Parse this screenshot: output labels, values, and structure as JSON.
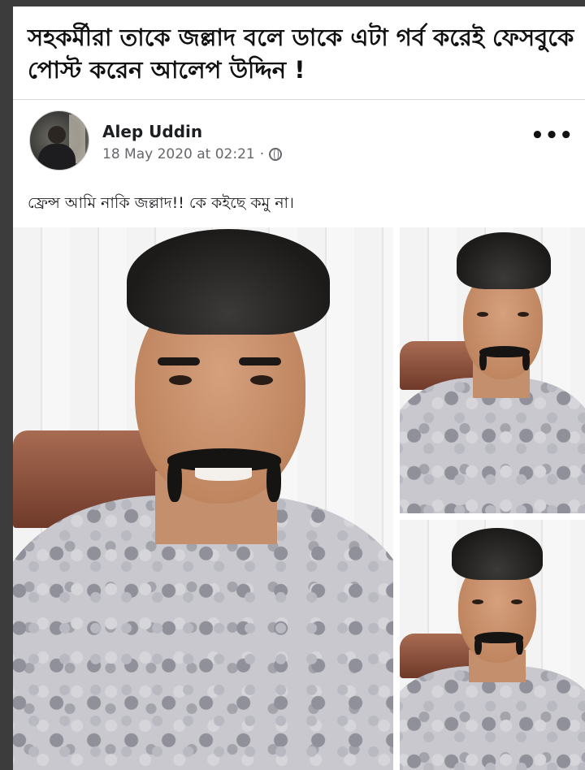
{
  "headline": "সহকর্মীরা তাকে জল্লাদ বলে ডাকে এটা গর্ব করেই ফেসবুকে পোস্ট করেন আলেপ উদ্দিন !",
  "post": {
    "author": "Alep Uddin",
    "timestamp": "18 May 2020 at 02:21",
    "separator": "·",
    "privacy_icon": "globe-icon",
    "more_label": "•••",
    "caption": "ফ্রেন্স আমি নাকি জল্লাদ!! কে কইছে কমু না।"
  },
  "colors": {
    "background": "#3c3c3c",
    "card": "#ffffff",
    "author_text": "#1c1e21",
    "meta_text": "#65676b"
  }
}
